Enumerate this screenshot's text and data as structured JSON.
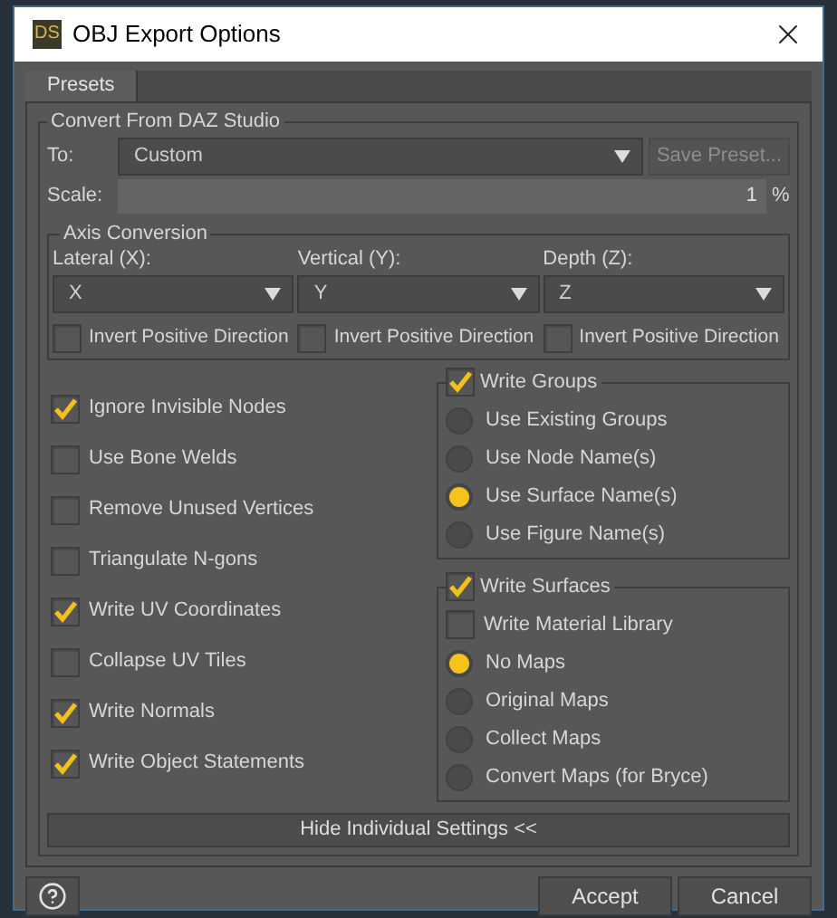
{
  "window": {
    "title": "OBJ Export Options",
    "logo_text": "DS"
  },
  "tabs": [
    {
      "label": "Presets",
      "selected": true
    }
  ],
  "convert": {
    "title": "Convert From DAZ Studio",
    "to_label": "To:",
    "to_value": "Custom",
    "save_preset": {
      "label": "Save Preset...",
      "disabled": true
    },
    "scale_label": "Scale:",
    "scale_value": "1",
    "scale_unit": "%"
  },
  "axis": {
    "title": "Axis Conversion",
    "columns": [
      {
        "label": "Lateral (X):",
        "value": "X",
        "invert": {
          "label": "Invert Positive Direction",
          "checked": false
        }
      },
      {
        "label": "Vertical (Y):",
        "value": "Y",
        "invert": {
          "label": "Invert Positive Direction",
          "checked": false
        }
      },
      {
        "label": "Depth (Z):",
        "value": "Z",
        "invert": {
          "label": "Invert Positive Direction",
          "checked": false
        }
      }
    ]
  },
  "options": [
    {
      "label": "Ignore Invisible Nodes",
      "checked": true
    },
    {
      "label": "Use Bone Welds",
      "checked": false
    },
    {
      "label": "Remove Unused Vertices",
      "checked": false
    },
    {
      "label": "Triangulate N-gons",
      "checked": false
    },
    {
      "label": "Write UV Coordinates",
      "checked": true
    },
    {
      "label": "Collapse UV Tiles",
      "checked": false
    },
    {
      "label": "Write Normals",
      "checked": true
    },
    {
      "label": "Write Object Statements",
      "checked": true
    }
  ],
  "groups": {
    "label": "Write Groups",
    "checked": true,
    "options": [
      {
        "label": "Use Existing Groups",
        "selected": false
      },
      {
        "label": "Use Node Name(s)",
        "selected": false
      },
      {
        "label": "Use Surface Name(s)",
        "selected": true
      },
      {
        "label": "Use Figure Name(s)",
        "selected": false
      }
    ]
  },
  "surfaces": {
    "label": "Write Surfaces",
    "checked": true,
    "material": {
      "label": "Write Material Library",
      "checked": false
    },
    "options": [
      {
        "label": "No Maps",
        "selected": true
      },
      {
        "label": "Original Maps",
        "selected": false
      },
      {
        "label": "Collect Maps",
        "selected": false
      },
      {
        "label": "Convert Maps (for Bryce)",
        "selected": false
      }
    ]
  },
  "toggle_button": "Hide Individual Settings <<",
  "footer": {
    "buttons": [
      "Accept",
      "Cancel"
    ]
  }
}
